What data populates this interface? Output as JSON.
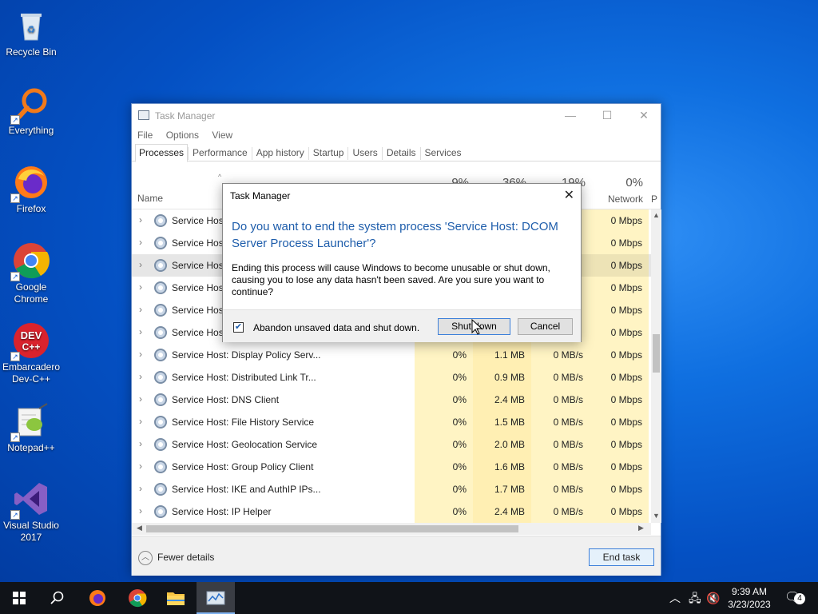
{
  "desktop": {
    "icons": [
      {
        "label": "Recycle Bin"
      },
      {
        "label": "Everything"
      },
      {
        "label": "Firefox"
      },
      {
        "label": "Google Chrome"
      },
      {
        "label": "Embarcadero Dev-C++"
      },
      {
        "label": "Notepad++"
      },
      {
        "label": "Visual Studio 2017"
      }
    ],
    "devcpp_badge": "DEV C++"
  },
  "task_manager": {
    "title": "Task Manager",
    "menu": [
      "File",
      "Options",
      "View"
    ],
    "tabs": [
      "Processes",
      "Performance",
      "App history",
      "Startup",
      "Users",
      "Details",
      "Services"
    ],
    "active_tab": "Processes",
    "columns": {
      "name": "Name",
      "cpu_pct": "9%",
      "mem_pct": "36%",
      "disk_pct": "19%",
      "net_pct": "0%",
      "net_label": "Network",
      "power_label": "P"
    },
    "rows": [
      {
        "name": "Service Host",
        "cpu": "",
        "mem": "",
        "disk": "",
        "net": "0 Mbps"
      },
      {
        "name": "Service Host",
        "cpu": "",
        "mem": "",
        "disk": "",
        "net": "0 Mbps"
      },
      {
        "name": "Service Host",
        "cpu": "",
        "mem": "",
        "disk": "",
        "net": "0 Mbps"
      },
      {
        "name": "Service Host",
        "cpu": "",
        "mem": "",
        "disk": "",
        "net": "0 Mbps"
      },
      {
        "name": "Service Host",
        "cpu": "",
        "mem": "",
        "disk": "",
        "net": "0 Mbps"
      },
      {
        "name": "Service Host",
        "cpu": "",
        "mem": "",
        "disk": "",
        "net": "0 Mbps"
      },
      {
        "name": "Service Host: Display Policy Serv...",
        "cpu": "0%",
        "mem": "1.1 MB",
        "disk": "0 MB/s",
        "net": "0 Mbps"
      },
      {
        "name": "Service Host: Distributed Link Tr...",
        "cpu": "0%",
        "mem": "0.9 MB",
        "disk": "0 MB/s",
        "net": "0 Mbps"
      },
      {
        "name": "Service Host: DNS Client",
        "cpu": "0%",
        "mem": "2.4 MB",
        "disk": "0 MB/s",
        "net": "0 Mbps"
      },
      {
        "name": "Service Host: File History Service",
        "cpu": "0%",
        "mem": "1.5 MB",
        "disk": "0 MB/s",
        "net": "0 Mbps"
      },
      {
        "name": "Service Host: Geolocation Service",
        "cpu": "0%",
        "mem": "2.0 MB",
        "disk": "0 MB/s",
        "net": "0 Mbps"
      },
      {
        "name": "Service Host: Group Policy Client",
        "cpu": "0%",
        "mem": "1.6 MB",
        "disk": "0 MB/s",
        "net": "0 Mbps"
      },
      {
        "name": "Service Host: IKE and AuthIP IPs...",
        "cpu": "0%",
        "mem": "1.7 MB",
        "disk": "0 MB/s",
        "net": "0 Mbps"
      },
      {
        "name": "Service Host: IP Helper",
        "cpu": "0%",
        "mem": "2.4 MB",
        "disk": "0 MB/s",
        "net": "0 Mbps"
      }
    ],
    "selected_row": 2,
    "fewer_details": "Fewer details",
    "end_task": "End task"
  },
  "dialog": {
    "title": "Task Manager",
    "question": "Do you want to end the system process 'Service Host: DCOM Server Process Launcher'?",
    "message": "Ending this process will cause Windows to become unusable or shut down, causing you to lose any data hasn't been saved. Are you sure you want to continue?",
    "checkbox_label": "Abandon unsaved data and shut down.",
    "checkbox_checked": true,
    "shutdown_label": "Shut down",
    "cancel_label": "Cancel"
  },
  "taskbar": {
    "time": "9:39 AM",
    "date": "3/23/2023",
    "notification_count": "4"
  },
  "colors": {
    "accent": "#3c7fd9",
    "heading_blue": "#1e5dab",
    "heat_light": "#fff4c4",
    "heat_dark": "#ffefb3"
  }
}
